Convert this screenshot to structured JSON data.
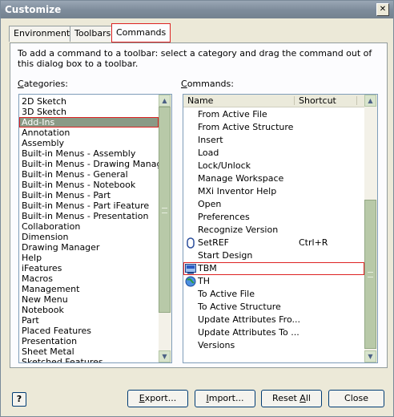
{
  "window": {
    "title": "Customize",
    "close_glyph": "✕"
  },
  "tabs": [
    {
      "label": "Environments",
      "active": false
    },
    {
      "label": "Toolbars",
      "active": false
    },
    {
      "label": "Commands",
      "active": true
    }
  ],
  "instructions": "To add a command to a toolbar: select a category and drag the command out of this dialog box to a toolbar.",
  "categories": {
    "label_prefix": "C",
    "label_rest": "ategories:",
    "selected": "Add-Ins",
    "items": [
      "2D Sketch",
      "3D Sketch",
      "Add-Ins",
      "Annotation",
      "Assembly",
      "Built-in Menus - Assembly",
      "Built-in Menus - Drawing Manager",
      "Built-in Menus - General",
      "Built-in Menus - Notebook",
      "Built-in Menus - Part",
      "Built-in Menus - Part iFeature",
      "Built-in Menus - Presentation",
      "Collaboration",
      "Dimension",
      "Drawing Manager",
      "Help",
      "iFeatures",
      "Macros",
      "Management",
      "New Menu",
      "Notebook",
      "Part",
      "Placed Features",
      "Presentation",
      "Sheet Metal",
      "Sketched Features"
    ]
  },
  "commands": {
    "label_prefix": "C",
    "label_rest": "ommands:",
    "columns": {
      "name": "Name",
      "shortcut": "Shortcut"
    },
    "items": [
      {
        "name": "From Active File",
        "shortcut": "",
        "icon": ""
      },
      {
        "name": "From Active Structure",
        "shortcut": "",
        "icon": ""
      },
      {
        "name": "Insert",
        "shortcut": "",
        "icon": ""
      },
      {
        "name": "Load",
        "shortcut": "",
        "icon": ""
      },
      {
        "name": "Lock/Unlock",
        "shortcut": "",
        "icon": ""
      },
      {
        "name": "Manage Workspace",
        "shortcut": "",
        "icon": ""
      },
      {
        "name": "MXi Inventor Help",
        "shortcut": "",
        "icon": ""
      },
      {
        "name": "Open",
        "shortcut": "",
        "icon": ""
      },
      {
        "name": "Preferences",
        "shortcut": "",
        "icon": ""
      },
      {
        "name": "Recognize Version",
        "shortcut": "",
        "icon": ""
      },
      {
        "name": "SetREF",
        "shortcut": "Ctrl+R",
        "icon": "ref-icon"
      },
      {
        "name": "Start Design",
        "shortcut": "",
        "icon": ""
      },
      {
        "name": "TBM",
        "shortcut": "",
        "icon": "tbm-icon"
      },
      {
        "name": "TH",
        "shortcut": "",
        "icon": "globe-icon"
      },
      {
        "name": "To Active File",
        "shortcut": "",
        "icon": ""
      },
      {
        "name": "To Active Structure",
        "shortcut": "",
        "icon": ""
      },
      {
        "name": "Update Attributes Fro...",
        "shortcut": "",
        "icon": ""
      },
      {
        "name": "Update Attributes To ...",
        "shortcut": "",
        "icon": ""
      },
      {
        "name": "Versions",
        "shortcut": "",
        "icon": ""
      }
    ],
    "highlighted": "TBM"
  },
  "buttons": {
    "help": "?",
    "export_u": "E",
    "export_rest": "xport...",
    "import_u": "I",
    "import_rest": "mport...",
    "reset_pre": "Reset ",
    "reset_u": "A",
    "reset_rest": "ll",
    "close": "Close"
  }
}
